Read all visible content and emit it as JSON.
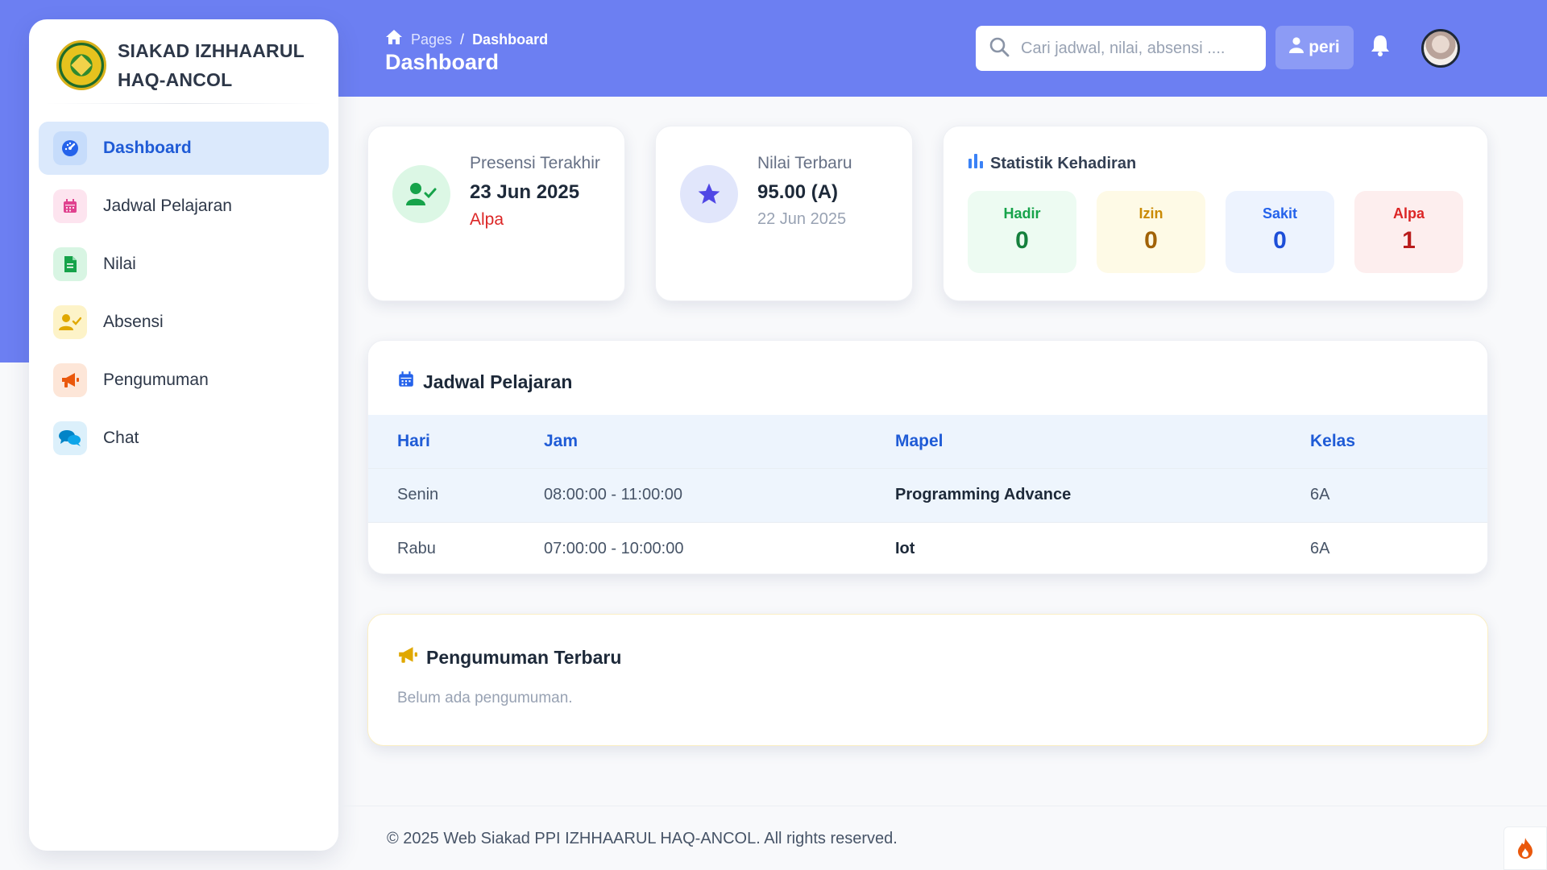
{
  "sidebar": {
    "brand": "SIAKAD IZHHAARUL HAQ-ANCOL",
    "items": [
      {
        "label": "Dashboard",
        "icon": "dashboard-icon"
      },
      {
        "label": "Jadwal Pelajaran",
        "icon": "calendar-icon"
      },
      {
        "label": "Nilai",
        "icon": "document-icon"
      },
      {
        "label": "Absensi",
        "icon": "user-check-icon"
      },
      {
        "label": "Pengumuman",
        "icon": "megaphone-icon"
      },
      {
        "label": "Chat",
        "icon": "chat-icon"
      }
    ],
    "active_index": 0
  },
  "header": {
    "breadcrumb_root": "Pages",
    "breadcrumb_sep": "/",
    "breadcrumb_current": "Dashboard",
    "title": "Dashboard",
    "search_placeholder": "Cari jadwal, nilai, absensi ....",
    "user_name": "peri"
  },
  "presensi": {
    "label": "Presensi Terakhir",
    "date": "23 Jun 2025",
    "status": "Alpa"
  },
  "nilai": {
    "label": "Nilai Terbaru",
    "value": "95.00 (A)",
    "date": "22 Jun 2025"
  },
  "kehadiran": {
    "title": "Statistik Kehadiran",
    "hadir_label": "Hadir",
    "hadir": "0",
    "izin_label": "Izin",
    "izin": "0",
    "sakit_label": "Sakit",
    "sakit": "0",
    "alpa_label": "Alpa",
    "alpa": "1"
  },
  "jadwal": {
    "title": "Jadwal Pelajaran",
    "columns": [
      "Hari",
      "Jam",
      "Mapel",
      "Kelas"
    ],
    "rows": [
      {
        "hari": "Senin",
        "jam": "08:00:00 - 11:00:00",
        "mapel": "Programming Advance",
        "kelas": "6A"
      },
      {
        "hari": "Rabu",
        "jam": "07:00:00 - 10:00:00",
        "mapel": "Iot",
        "kelas": "6A"
      }
    ]
  },
  "pengumuman": {
    "title": "Pengumuman Terbaru",
    "empty_text": "Belum ada pengumuman."
  },
  "footer": {
    "text": "© 2025 Web Siakad PPI IZHHAARUL HAQ-ANCOL. All rights reserved."
  },
  "colors": {
    "header_band": "#6c7ff2",
    "accent": "#1f5bd6",
    "danger": "#dc2626"
  }
}
